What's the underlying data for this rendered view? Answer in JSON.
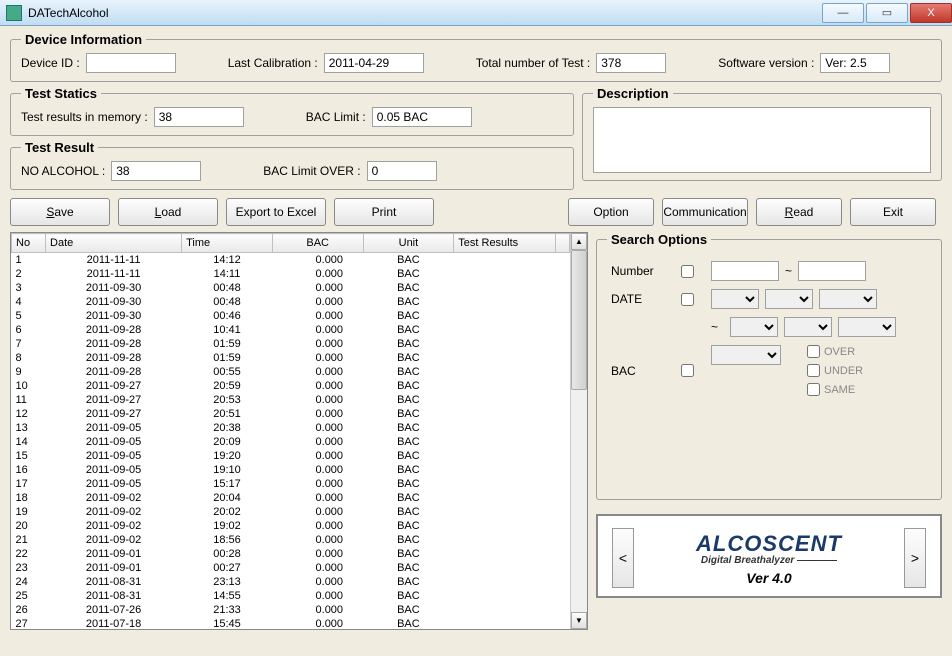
{
  "window": {
    "title": "DATechAlcohol",
    "min": "—",
    "max": "▭",
    "close": "X"
  },
  "deviceInfo": {
    "legend": "Device Information",
    "deviceIdLabel": "Device ID :",
    "deviceId": "",
    "lastCalLabel": "Last Calibration :",
    "lastCal": "2011-04-29",
    "totalLabel": "Total number of Test :",
    "total": "378",
    "swLabel": "Software version :",
    "sw": "Ver: 2.5"
  },
  "testStatics": {
    "legend": "Test Statics",
    "memLabel": "Test results in memory :",
    "mem": "38",
    "limitLabel": "BAC Limit :",
    "limit": "0.05 BAC"
  },
  "testResult": {
    "legend": "Test Result",
    "noAlcLabel": "NO ALCOHOL :",
    "noAlc": "38",
    "overLabel": "BAC Limit OVER :",
    "over": "0"
  },
  "description": {
    "legend": "Description",
    "text": ""
  },
  "buttons": {
    "save": "Save",
    "load": "Load",
    "export": "Export to Excel",
    "print": "Print",
    "option": "Option",
    "comm": "Communication",
    "read": "Read",
    "exit": "Exit"
  },
  "table": {
    "headers": {
      "no": "No",
      "date": "Date",
      "time": "Time",
      "bac": "BAC",
      "unit": "Unit",
      "res": "Test Results"
    },
    "rows": [
      {
        "no": "1",
        "date": "2011-11-11",
        "time": "14:12",
        "bac": "0.000",
        "unit": "BAC"
      },
      {
        "no": "2",
        "date": "2011-11-11",
        "time": "14:11",
        "bac": "0.000",
        "unit": "BAC"
      },
      {
        "no": "3",
        "date": "2011-09-30",
        "time": "00:48",
        "bac": "0.000",
        "unit": "BAC"
      },
      {
        "no": "4",
        "date": "2011-09-30",
        "time": "00:48",
        "bac": "0.000",
        "unit": "BAC"
      },
      {
        "no": "5",
        "date": "2011-09-30",
        "time": "00:46",
        "bac": "0.000",
        "unit": "BAC"
      },
      {
        "no": "6",
        "date": "2011-09-28",
        "time": "10:41",
        "bac": "0.000",
        "unit": "BAC"
      },
      {
        "no": "7",
        "date": "2011-09-28",
        "time": "01:59",
        "bac": "0.000",
        "unit": "BAC"
      },
      {
        "no": "8",
        "date": "2011-09-28",
        "time": "01:59",
        "bac": "0.000",
        "unit": "BAC"
      },
      {
        "no": "9",
        "date": "2011-09-28",
        "time": "00:55",
        "bac": "0.000",
        "unit": "BAC"
      },
      {
        "no": "10",
        "date": "2011-09-27",
        "time": "20:59",
        "bac": "0.000",
        "unit": "BAC"
      },
      {
        "no": "11",
        "date": "2011-09-27",
        "time": "20:53",
        "bac": "0.000",
        "unit": "BAC"
      },
      {
        "no": "12",
        "date": "2011-09-27",
        "time": "20:51",
        "bac": "0.000",
        "unit": "BAC"
      },
      {
        "no": "13",
        "date": "2011-09-05",
        "time": "20:38",
        "bac": "0.000",
        "unit": "BAC"
      },
      {
        "no": "14",
        "date": "2011-09-05",
        "time": "20:09",
        "bac": "0.000",
        "unit": "BAC"
      },
      {
        "no": "15",
        "date": "2011-09-05",
        "time": "19:20",
        "bac": "0.000",
        "unit": "BAC"
      },
      {
        "no": "16",
        "date": "2011-09-05",
        "time": "19:10",
        "bac": "0.000",
        "unit": "BAC"
      },
      {
        "no": "17",
        "date": "2011-09-05",
        "time": "15:17",
        "bac": "0.000",
        "unit": "BAC"
      },
      {
        "no": "18",
        "date": "2011-09-02",
        "time": "20:04",
        "bac": "0.000",
        "unit": "BAC"
      },
      {
        "no": "19",
        "date": "2011-09-02",
        "time": "20:02",
        "bac": "0.000",
        "unit": "BAC"
      },
      {
        "no": "20",
        "date": "2011-09-02",
        "time": "19:02",
        "bac": "0.000",
        "unit": "BAC"
      },
      {
        "no": "21",
        "date": "2011-09-02",
        "time": "18:56",
        "bac": "0.000",
        "unit": "BAC"
      },
      {
        "no": "22",
        "date": "2011-09-01",
        "time": "00:28",
        "bac": "0.000",
        "unit": "BAC"
      },
      {
        "no": "23",
        "date": "2011-09-01",
        "time": "00:27",
        "bac": "0.000",
        "unit": "BAC"
      },
      {
        "no": "24",
        "date": "2011-08-31",
        "time": "23:13",
        "bac": "0.000",
        "unit": "BAC"
      },
      {
        "no": "25",
        "date": "2011-08-31",
        "time": "14:55",
        "bac": "0.000",
        "unit": "BAC"
      },
      {
        "no": "26",
        "date": "2011-07-26",
        "time": "21:33",
        "bac": "0.000",
        "unit": "BAC"
      },
      {
        "no": "27",
        "date": "2011-07-18",
        "time": "15:45",
        "bac": "0.000",
        "unit": "BAC"
      }
    ]
  },
  "search": {
    "legend": "Search Options",
    "numberLabel": "Number",
    "dateLabel": "DATE",
    "bacLabel": "BAC",
    "tilde": "~",
    "over": "OVER",
    "under": "UNDER",
    "same": "SAME"
  },
  "logo": {
    "name": "ALCOSCENT",
    "tag": "Digital Breathalyzer ————",
    "ver": "Ver 4.0",
    "left": "<",
    "right": ">"
  }
}
